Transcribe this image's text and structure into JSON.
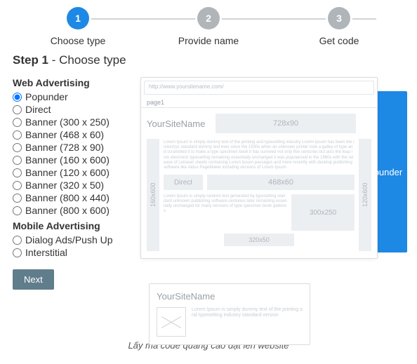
{
  "stepper": {
    "steps": [
      {
        "num": "1",
        "label": "Choose type"
      },
      {
        "num": "2",
        "label": "Provide name"
      },
      {
        "num": "3",
        "label": "Get code"
      }
    ]
  },
  "heading": {
    "bold": "Step 1",
    "rest": " - Choose type"
  },
  "groups": {
    "web_title": "Web Advertising",
    "mobile_title": "Mobile Advertising"
  },
  "options": {
    "web": [
      "Popunder",
      "Direct",
      "Banner (300 x 250)",
      "Banner (468 x 60)",
      "Banner (728 x 90)",
      "Banner (160 x 600)",
      "Banner (120 x 600)",
      "Banner (320 x 50)",
      "Banner (800 x 440)",
      "Banner (800 x 600)"
    ],
    "mobile": [
      "Dialog Ads/Push Up",
      "Interstitial"
    ]
  },
  "next_label": "Next",
  "preview": {
    "addr": "http://www.yoursitename.com/",
    "tab": "page1",
    "site": "YourSiteName",
    "b728": "728x90",
    "b160": "160x600",
    "b120": "120x600",
    "direct": "Direct",
    "b468": "468x60",
    "b300": "300x250",
    "b320": "320x50",
    "popunder": "Popunder",
    "filler1": "Lorem Ipsum is simply dummy text of the printing and typesetting industry Lorem Ipsum has been the industrys standard dummy text ever since the 1500s when an unknown printer took a galley of type and scrambled it to make a type specimen book it has survived not only five centuries but also the leap into electronic typesetting remaining essentially unchanged it was popularised in the 1960s with the release of Letraset sheets containing Lorem Ipsum passages and more recently with desktop publishing software like Aldus PageMaker including versions of Lorem Ipsum",
    "filler2": "Lorem Ipsum is simply random text generated by typesetting standard unknown publishing software centuries later remaining essentially unchanged for many versions of type specimen book galleries",
    "filler3": "Lorem Ipsum is simply dummy text of the printing and typesetting industry standard version"
  },
  "caption": "Lấy mã code quảng cáo đặt lên website"
}
